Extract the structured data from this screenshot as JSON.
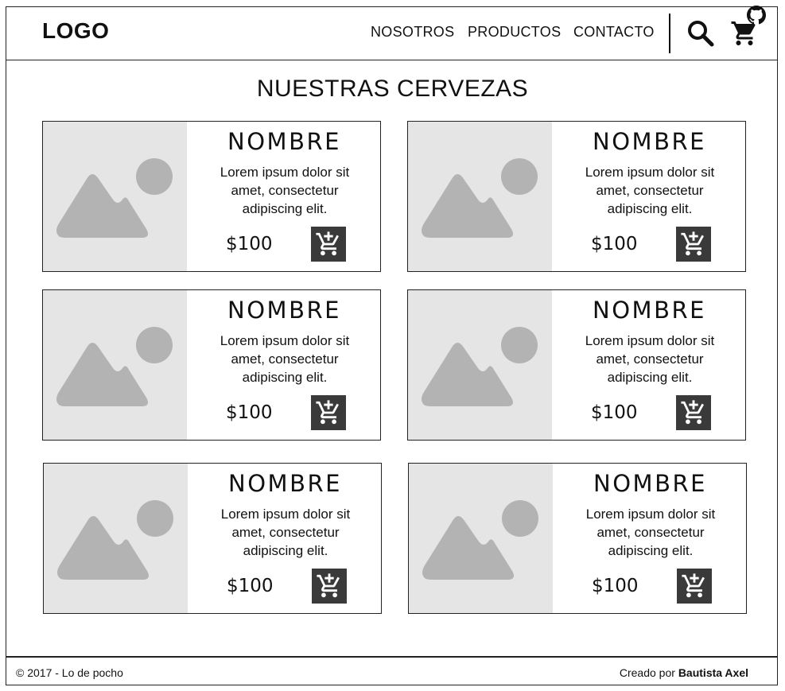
{
  "header": {
    "logo": "LOGO",
    "nav": [
      "NOSOTROS",
      "PRODUCTOS",
      "CONTACTO"
    ],
    "icons": [
      "search-icon",
      "cart-icon"
    ]
  },
  "main": {
    "title": "NUESTRAS CERVEZAS",
    "products": [
      {
        "name": "NOMBRE",
        "description": "Lorem ipsum dolor sit amet, consectetur adipiscing elit.",
        "price": "$100"
      },
      {
        "name": "NOMBRE",
        "description": "Lorem ipsum dolor sit amet, consectetur adipiscing elit.",
        "price": "$100"
      },
      {
        "name": "NOMBRE",
        "description": "Lorem ipsum dolor sit amet, consectetur adipiscing elit.",
        "price": "$100"
      },
      {
        "name": "NOMBRE",
        "description": "Lorem ipsum dolor sit amet, consectetur adipiscing elit.",
        "price": "$100"
      },
      {
        "name": "NOMBRE",
        "description": "Lorem ipsum dolor sit amet, consectetur adipiscing elit.",
        "price": "$100"
      },
      {
        "name": "NOMBRE",
        "description": "Lorem ipsum dolor sit amet, consectetur adipiscing elit.",
        "price": "$100"
      }
    ]
  },
  "footer": {
    "copyright": "© 2017 - Lo de pocho",
    "credit_prefix": "Creado por",
    "credit_author": "Bautista Axel",
    "icon": "github-icon"
  },
  "colors": {
    "image_placeholder_bg": "#e5e5e5",
    "image_placeholder_fg": "#b3b3b3",
    "add_button_bg": "#3a3a3a"
  }
}
